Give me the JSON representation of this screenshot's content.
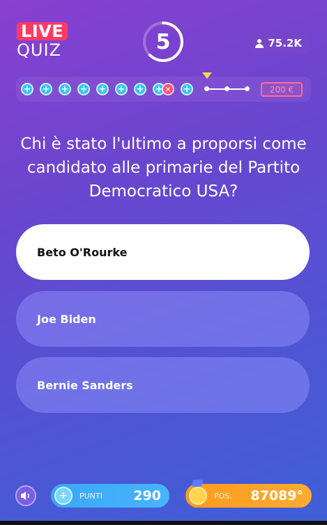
{
  "header": {
    "logo_top": "LIVE",
    "logo_bottom": "QUIZ",
    "timer": "5",
    "viewers": "75.2K"
  },
  "progress": {
    "steps_completed": 9,
    "wrong_step_index": 7,
    "prize": "200 €"
  },
  "question": "Chi è stato l'ultimo a proporsi come candidato alle primarie del Partito Democratico USA?",
  "answers": [
    {
      "label": "Beto O'Rourke",
      "selected": true
    },
    {
      "label": "Joe Biden",
      "selected": false
    },
    {
      "label": "Bernie Sanders",
      "selected": false
    }
  ],
  "footer": {
    "points_label": "PUNTI",
    "points_value": "290",
    "position_label": "POS.",
    "position_value": "87089°"
  },
  "colors": {
    "live_badge": "#ff3b64",
    "points_pill": "#3aa8f5",
    "position_pill": "#ff9a1f",
    "marker": "#ffd84a"
  }
}
